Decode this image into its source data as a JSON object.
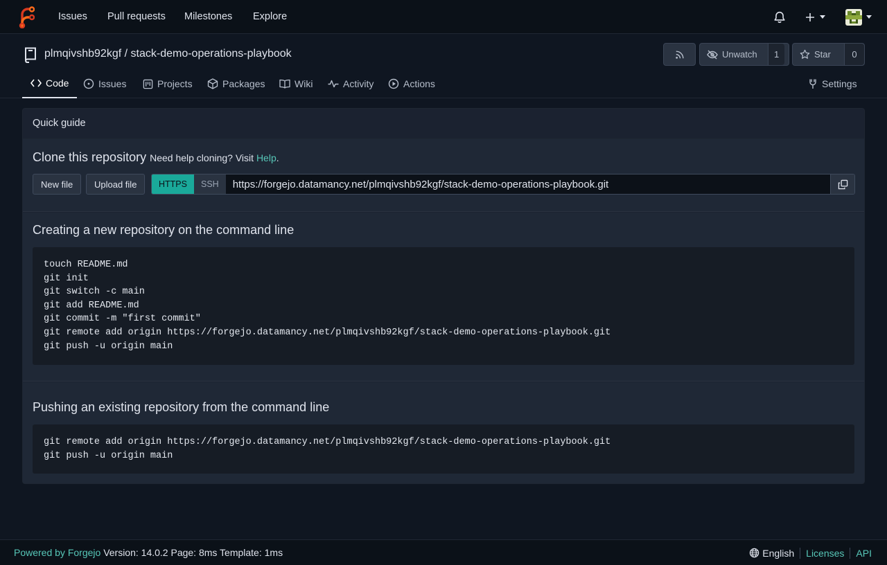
{
  "navbar": {
    "links": [
      "Issues",
      "Pull requests",
      "Milestones",
      "Explore"
    ]
  },
  "repo": {
    "owner": "plmqivshb92kgf",
    "separator": "/",
    "name": "stack-demo-operations-playbook",
    "unwatch_label": "Unwatch",
    "watch_count": "1",
    "star_label": "Star",
    "star_count": "0"
  },
  "tabs": {
    "code": "Code",
    "issues": "Issues",
    "projects": "Projects",
    "packages": "Packages",
    "wiki": "Wiki",
    "activity": "Activity",
    "actions": "Actions",
    "settings": "Settings"
  },
  "guide": {
    "title": "Quick guide",
    "clone_title": "Clone this repository",
    "help_text": "Need help cloning? Visit",
    "help_link": "Help",
    "help_period": ".",
    "new_file": "New file",
    "upload_file": "Upload file",
    "https_label": "HTTPS",
    "ssh_label": "SSH",
    "clone_url": "https://forgejo.datamancy.net/plmqivshb92kgf/stack-demo-operations-playbook.git",
    "new_repo_title": "Creating a new repository on the command line",
    "new_repo_cmds": [
      "touch README.md",
      "git init",
      "git switch -c main",
      "git add README.md",
      "git commit -m \"first commit\"",
      "git remote add origin https://forgejo.datamancy.net/plmqivshb92kgf/stack-demo-operations-playbook.git",
      "git push -u origin main"
    ],
    "push_title": "Pushing an existing repository from the command line",
    "push_cmds": [
      "git remote add origin https://forgejo.datamancy.net/plmqivshb92kgf/stack-demo-operations-playbook.git",
      "git push -u origin main"
    ]
  },
  "footer": {
    "powered_by": "Powered by Forgejo",
    "version": "Version: 14.0.2 Page: 8ms Template: 1ms",
    "language": "English",
    "licenses": "Licenses",
    "api": "API"
  },
  "colors": {
    "accent": "#1aa99a",
    "link": "#57c7b8",
    "background": "#0f1621"
  },
  "icons": [
    "forgejo-logo-icon",
    "bell-icon",
    "plus-icon",
    "avatar",
    "repo-icon",
    "rss-icon",
    "eye-slash-icon",
    "star-icon",
    "code-icon",
    "issue-icon",
    "project-icon",
    "package-icon",
    "book-icon",
    "pulse-icon",
    "play-icon",
    "tools-icon",
    "copy-icon",
    "globe-icon"
  ]
}
